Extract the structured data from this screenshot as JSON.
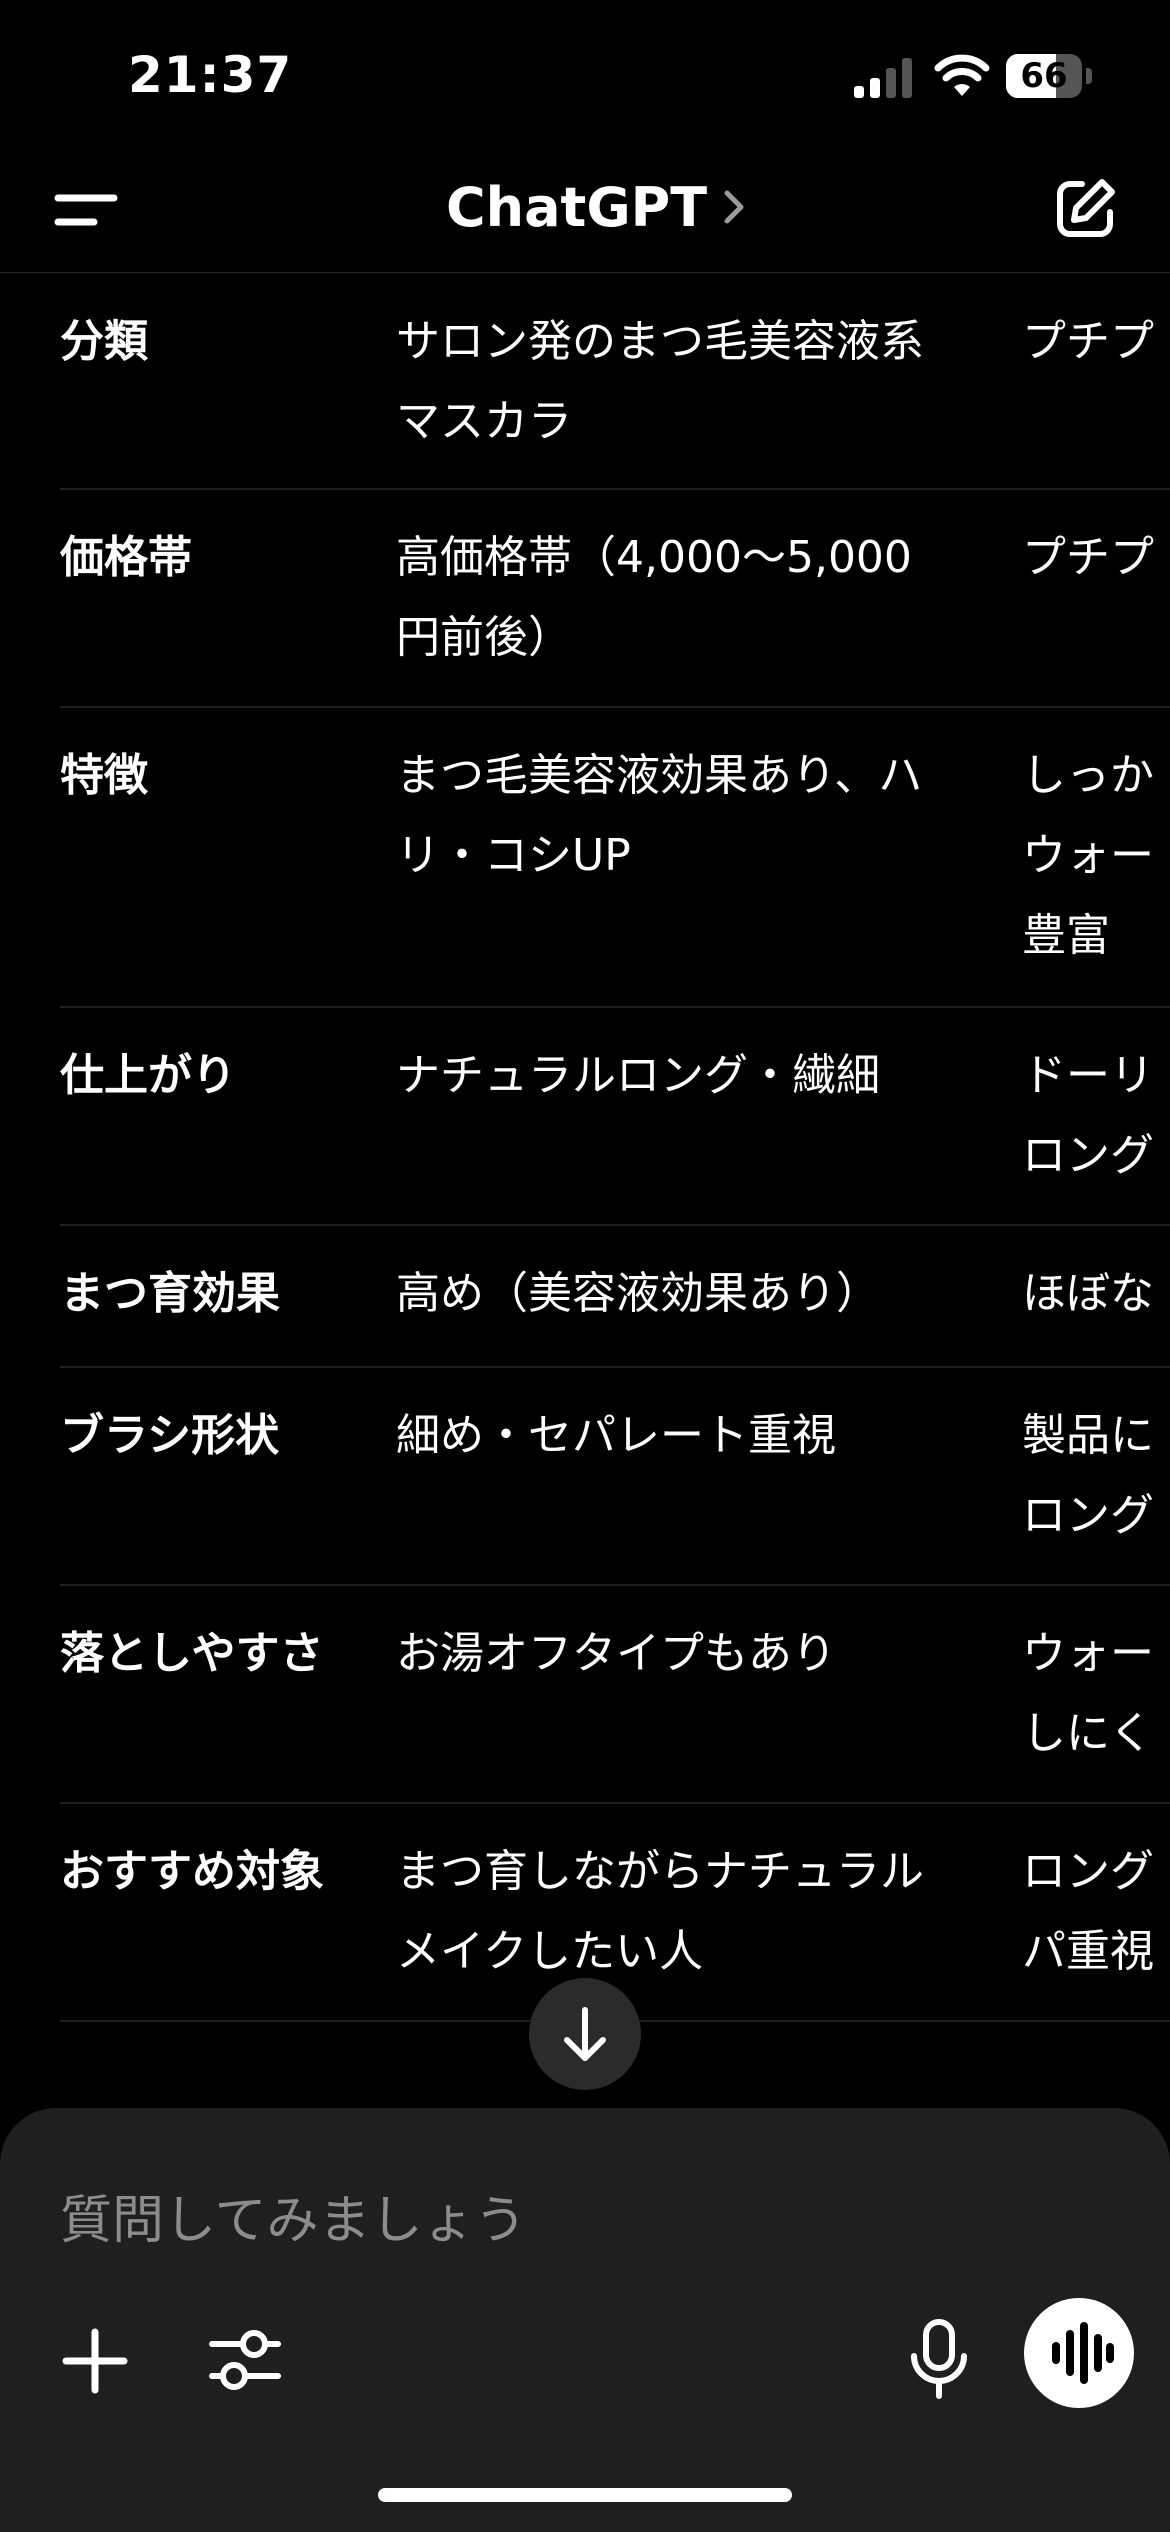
{
  "status_bar": {
    "time": "21:37",
    "battery": "66",
    "battery_level": 0.66
  },
  "header": {
    "title": "ChatGPT"
  },
  "table": {
    "rows": [
      {
        "label": "分類",
        "col_a": [
          "サロン発のまつ毛美容液系",
          "マスカラ"
        ],
        "col_b": [
          "プチプ"
        ]
      },
      {
        "label": "価格帯",
        "col_a": [
          "高価格帯（4,000〜5,000",
          "円前後）"
        ],
        "col_b": [
          "プチプ"
        ]
      },
      {
        "label": "特徴",
        "col_a": [
          "まつ毛美容液効果あり、ハ",
          "リ・コシUP"
        ],
        "col_b": [
          "しっか",
          "ウォー",
          "豊富"
        ]
      },
      {
        "label": "仕上がり",
        "col_a": [
          "ナチュラルロング・繊細"
        ],
        "col_b": [
          "ドーリ",
          "ロング"
        ]
      },
      {
        "label": "まつ育効果",
        "col_a": [
          "高め（美容液効果あり）"
        ],
        "col_b": [
          "ほぼな"
        ]
      },
      {
        "label": "ブラシ形状",
        "col_a": [
          "細め・セパレート重視"
        ],
        "col_b": [
          "製品に",
          "ロング"
        ]
      },
      {
        "label": "落としやすさ",
        "col_a": [
          "お湯オフタイプもあり"
        ],
        "col_b": [
          "ウォー",
          "しにく"
        ]
      },
      {
        "label": "おすすめ対象",
        "col_a": [
          "まつ育しながらナチュラル",
          "メイクしたい人"
        ],
        "col_b": [
          "ロング",
          "パ重視"
        ]
      }
    ]
  },
  "composer": {
    "placeholder": "質問してみましょう"
  },
  "icons": {
    "menu": "menu-icon",
    "chevron": "chevron-right-icon",
    "new_chat": "edit-icon",
    "scroll_down": "arrow-down-icon",
    "add": "plus-icon",
    "tools": "sliders-icon",
    "mic": "microphone-icon",
    "voice": "waveform-icon"
  }
}
